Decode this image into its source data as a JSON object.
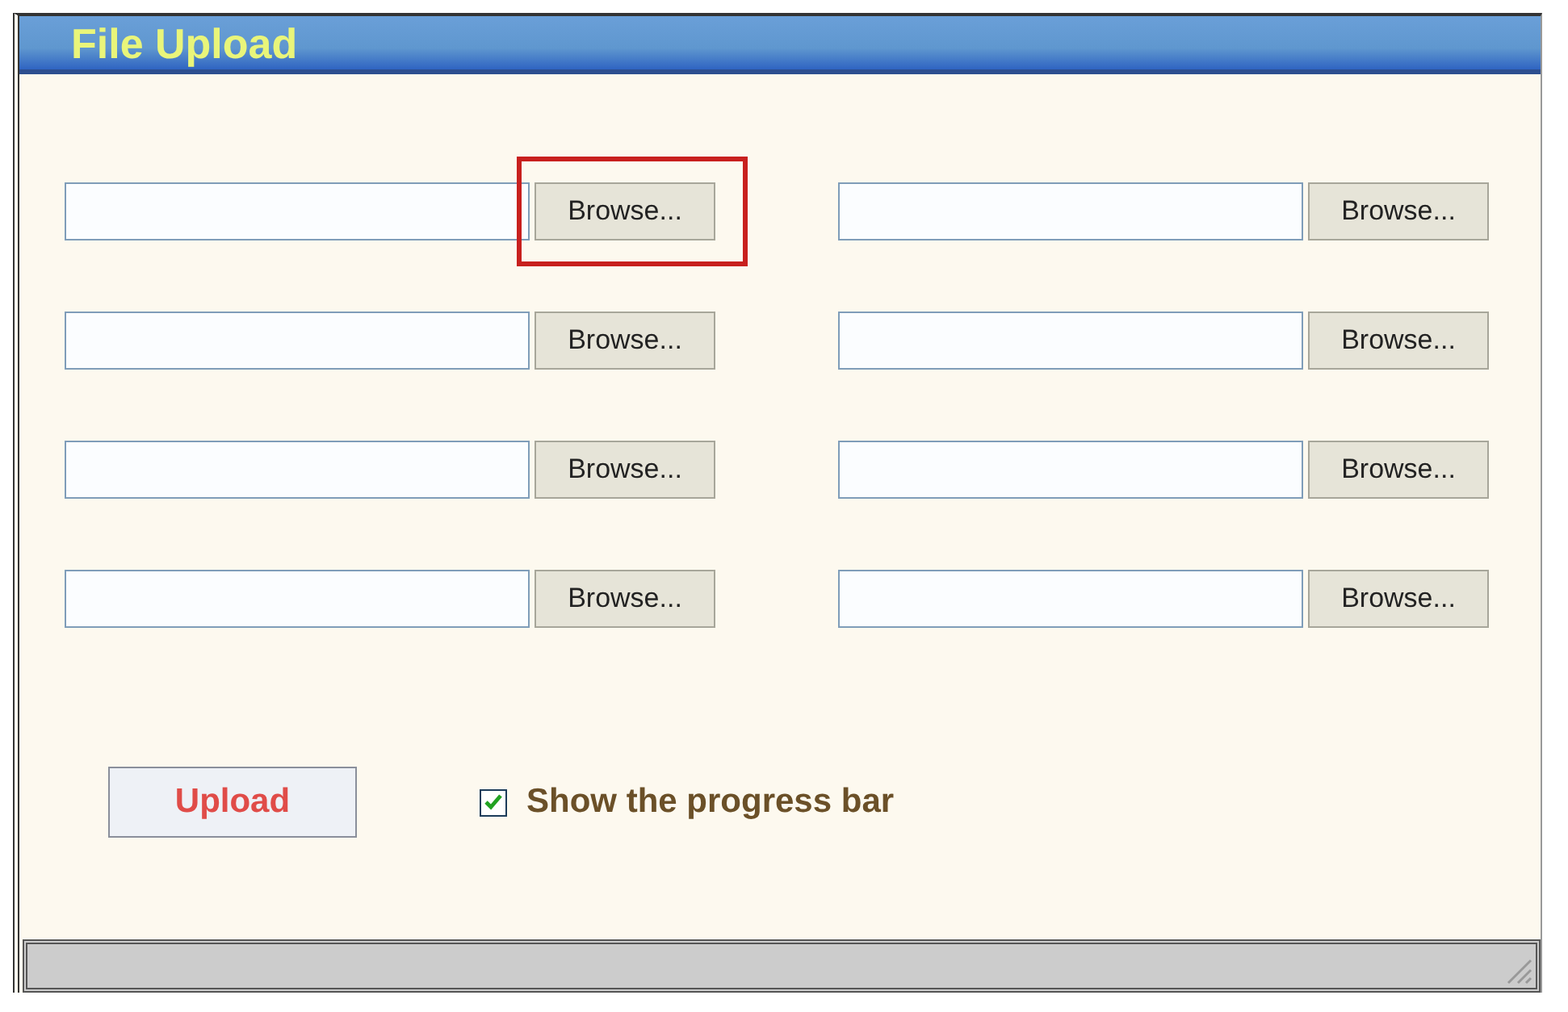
{
  "window": {
    "title": "File Upload"
  },
  "file_inputs": [
    {
      "button": "Browse...",
      "highlighted": true
    },
    {
      "button": "Browse...",
      "highlighted": false
    },
    {
      "button": "Browse...",
      "highlighted": false
    },
    {
      "button": "Browse...",
      "highlighted": false
    },
    {
      "button": "Browse...",
      "highlighted": false
    },
    {
      "button": "Browse...",
      "highlighted": false
    },
    {
      "button": "Browse...",
      "highlighted": false
    },
    {
      "button": "Browse...",
      "highlighted": false
    }
  ],
  "upload_button": "Upload",
  "progress_option": {
    "label": "Show the progress bar",
    "checked": true
  }
}
